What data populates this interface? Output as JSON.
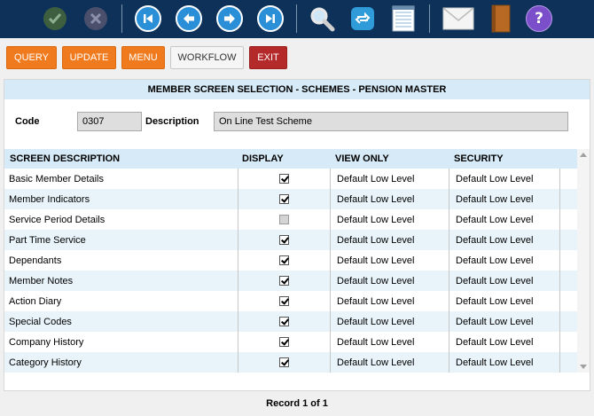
{
  "toolbar": {
    "icons": [
      "check-icon",
      "cancel-icon",
      "first-record-icon",
      "previous-record-icon",
      "next-record-icon",
      "last-record-icon",
      "search-icon",
      "refresh-icon",
      "notepad-icon",
      "mail-icon",
      "book-icon",
      "help-icon"
    ],
    "help_glyph": "?"
  },
  "actions": {
    "query": "QUERY",
    "update": "UPDATE",
    "menu": "MENU",
    "workflow": "WORKFLOW",
    "exit": "EXIT"
  },
  "panel": {
    "title": "MEMBER SCREEN SELECTION - SCHEMES - PENSION MASTER",
    "code_label": "Code",
    "code_value": "0307",
    "description_label": "Description",
    "description_value": "On Line Test Scheme"
  },
  "grid": {
    "columns": [
      "SCREEN DESCRIPTION",
      "DISPLAY",
      "VIEW ONLY",
      "SECURITY"
    ],
    "rows": [
      {
        "desc": "Basic Member Details",
        "display": true,
        "enabled": true,
        "view": "Default Low Level",
        "security": "Default Low Level"
      },
      {
        "desc": "Member Indicators",
        "display": true,
        "enabled": true,
        "view": "Default Low Level",
        "security": "Default Low Level"
      },
      {
        "desc": "Service Period Details",
        "display": false,
        "enabled": false,
        "view": "Default Low Level",
        "security": "Default Low Level"
      },
      {
        "desc": "Part Time Service",
        "display": true,
        "enabled": true,
        "view": "Default Low Level",
        "security": "Default Low Level"
      },
      {
        "desc": "Dependants",
        "display": true,
        "enabled": true,
        "view": "Default Low Level",
        "security": "Default Low Level"
      },
      {
        "desc": "Member Notes",
        "display": true,
        "enabled": true,
        "view": "Default Low Level",
        "security": "Default Low Level"
      },
      {
        "desc": "Action Diary",
        "display": true,
        "enabled": true,
        "view": "Default Low Level",
        "security": "Default Low Level"
      },
      {
        "desc": "Special Codes",
        "display": true,
        "enabled": true,
        "view": "Default Low Level",
        "security": "Default Low Level"
      },
      {
        "desc": "Company History",
        "display": true,
        "enabled": true,
        "view": "Default Low Level",
        "security": "Default Low Level"
      },
      {
        "desc": "Category History",
        "display": true,
        "enabled": true,
        "view": "Default Low Level",
        "security": "Default Low Level"
      }
    ]
  },
  "footer": {
    "record_text": "Record 1 of 1"
  },
  "colors": {
    "toolbar_bg": "#0d3158",
    "accent_orange": "#f07b1f",
    "exit_red": "#b42a2a",
    "header_blue": "#d6eaf7",
    "row_alt": "#e8f3fa"
  }
}
